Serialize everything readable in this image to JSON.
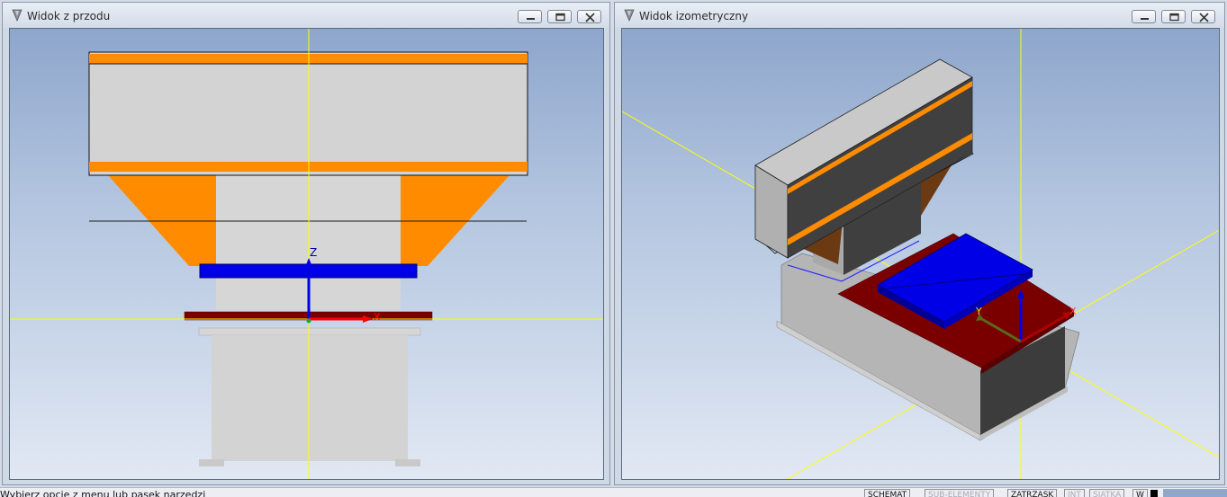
{
  "windows": {
    "front": {
      "title": "Widok z przodu",
      "axis_label": "Z",
      "x_label": "X"
    },
    "iso": {
      "title": "Widok izometryczny",
      "y_label": "Y",
      "x_label": "X"
    }
  },
  "titlebar_icons": [
    "app-icon",
    "minimize-icon",
    "restore-icon",
    "close-icon"
  ],
  "colors": {
    "orange": "#ff8c00",
    "blue": "#0000e6",
    "dark_red": "#7a0000",
    "light_grey": "#d3d3d3",
    "dark_grey": "#3c3c3c",
    "axis_yellow": "#ffff00"
  },
  "status": {
    "message": "Wybierz opcję z menu lub pasek narzędzi",
    "indicators": [
      {
        "label": "SCHEMAT",
        "active": true
      },
      {
        "label": "SUB-ELEMENTY",
        "active": false
      },
      {
        "label": "ZATRZASK",
        "active": true
      },
      {
        "label": "INT",
        "active": false
      },
      {
        "label": "SIATKA",
        "active": false
      },
      {
        "label": "W",
        "active": true
      }
    ]
  }
}
